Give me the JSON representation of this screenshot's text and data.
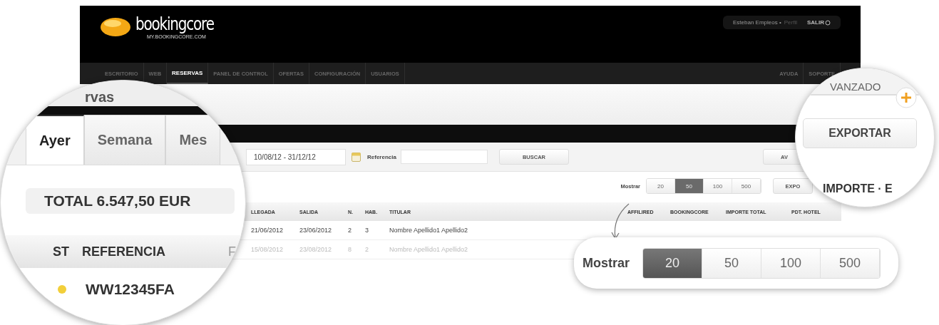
{
  "header": {
    "logo": {
      "name": "bookingcore",
      "subtitle": "MY.BOOKINGCORE.COM"
    },
    "user": {
      "name": "Esteban Empleos •",
      "profile_link": "Perfil",
      "logout": "SALIR"
    }
  },
  "nav": {
    "items": [
      {
        "label": "ESCRITORIO",
        "selected": false
      },
      {
        "label": "WEB",
        "selected": false
      },
      {
        "label": "RESERVAS",
        "selected": true
      },
      {
        "label": "PANEL DE CONTROL",
        "selected": false
      },
      {
        "label": "OFERTAS",
        "selected": false
      },
      {
        "label": "CONFIGURACIÓN",
        "selected": false
      },
      {
        "label": "USUARIOS",
        "selected": false
      }
    ],
    "right_items": [
      "AYUDA",
      "SOPORTE"
    ]
  },
  "filters": {
    "date_range": "10/08/12 - 31/12/12",
    "reference_label": "Referencia",
    "search_button": "BUSCAR",
    "advanced_button": "AV"
  },
  "toolbar": {
    "show_label": "Mostrar",
    "page_sizes": [
      {
        "label": "20",
        "selected": false
      },
      {
        "label": "50",
        "selected": true
      },
      {
        "label": "100",
        "selected": false
      },
      {
        "label": "500",
        "selected": false
      }
    ],
    "export_button": "EXPO"
  },
  "table": {
    "columns": [
      "LLEGADA",
      "SALIDA",
      "N.",
      "HAB.",
      "TITULAR",
      "AFFILIRED",
      "BOOKINGCORE",
      "IMPORTE TOTAL",
      "PDT. HOTEL"
    ],
    "rows": [
      {
        "cells": [
          "21/06/2012",
          "23/06/2012",
          "2",
          "3",
          "Nombre Apellido1 Apellido2"
        ],
        "disabled": false
      },
      {
        "cells": [
          "15/08/2012",
          "23/08/2012",
          "8",
          "2",
          "Nombre Apellido1 Apellido2"
        ],
        "disabled": true
      }
    ]
  },
  "magnifier_left": {
    "title": "rvas",
    "tabs": [
      {
        "label": "Ayer",
        "selected": true
      },
      {
        "label": "Semana",
        "selected": false
      },
      {
        "label": "Mes",
        "selected": false
      }
    ],
    "total": "TOTAL 6.547,50 EUR",
    "columns": [
      "ST",
      "REFERENCIA",
      "F"
    ],
    "rows": [
      {
        "color": "#f2cf3a",
        "reference": "WW12345FA"
      }
    ]
  },
  "magnifier_right": {
    "title": "VANZADO",
    "export_button": "EXPORTAR",
    "column": "IMPORTE · E"
  },
  "callout": {
    "label": "Mostrar",
    "page_sizes": [
      {
        "label": "20",
        "selected": true
      },
      {
        "label": "50",
        "selected": false
      },
      {
        "label": "100",
        "selected": false
      },
      {
        "label": "500",
        "selected": false
      }
    ]
  }
}
